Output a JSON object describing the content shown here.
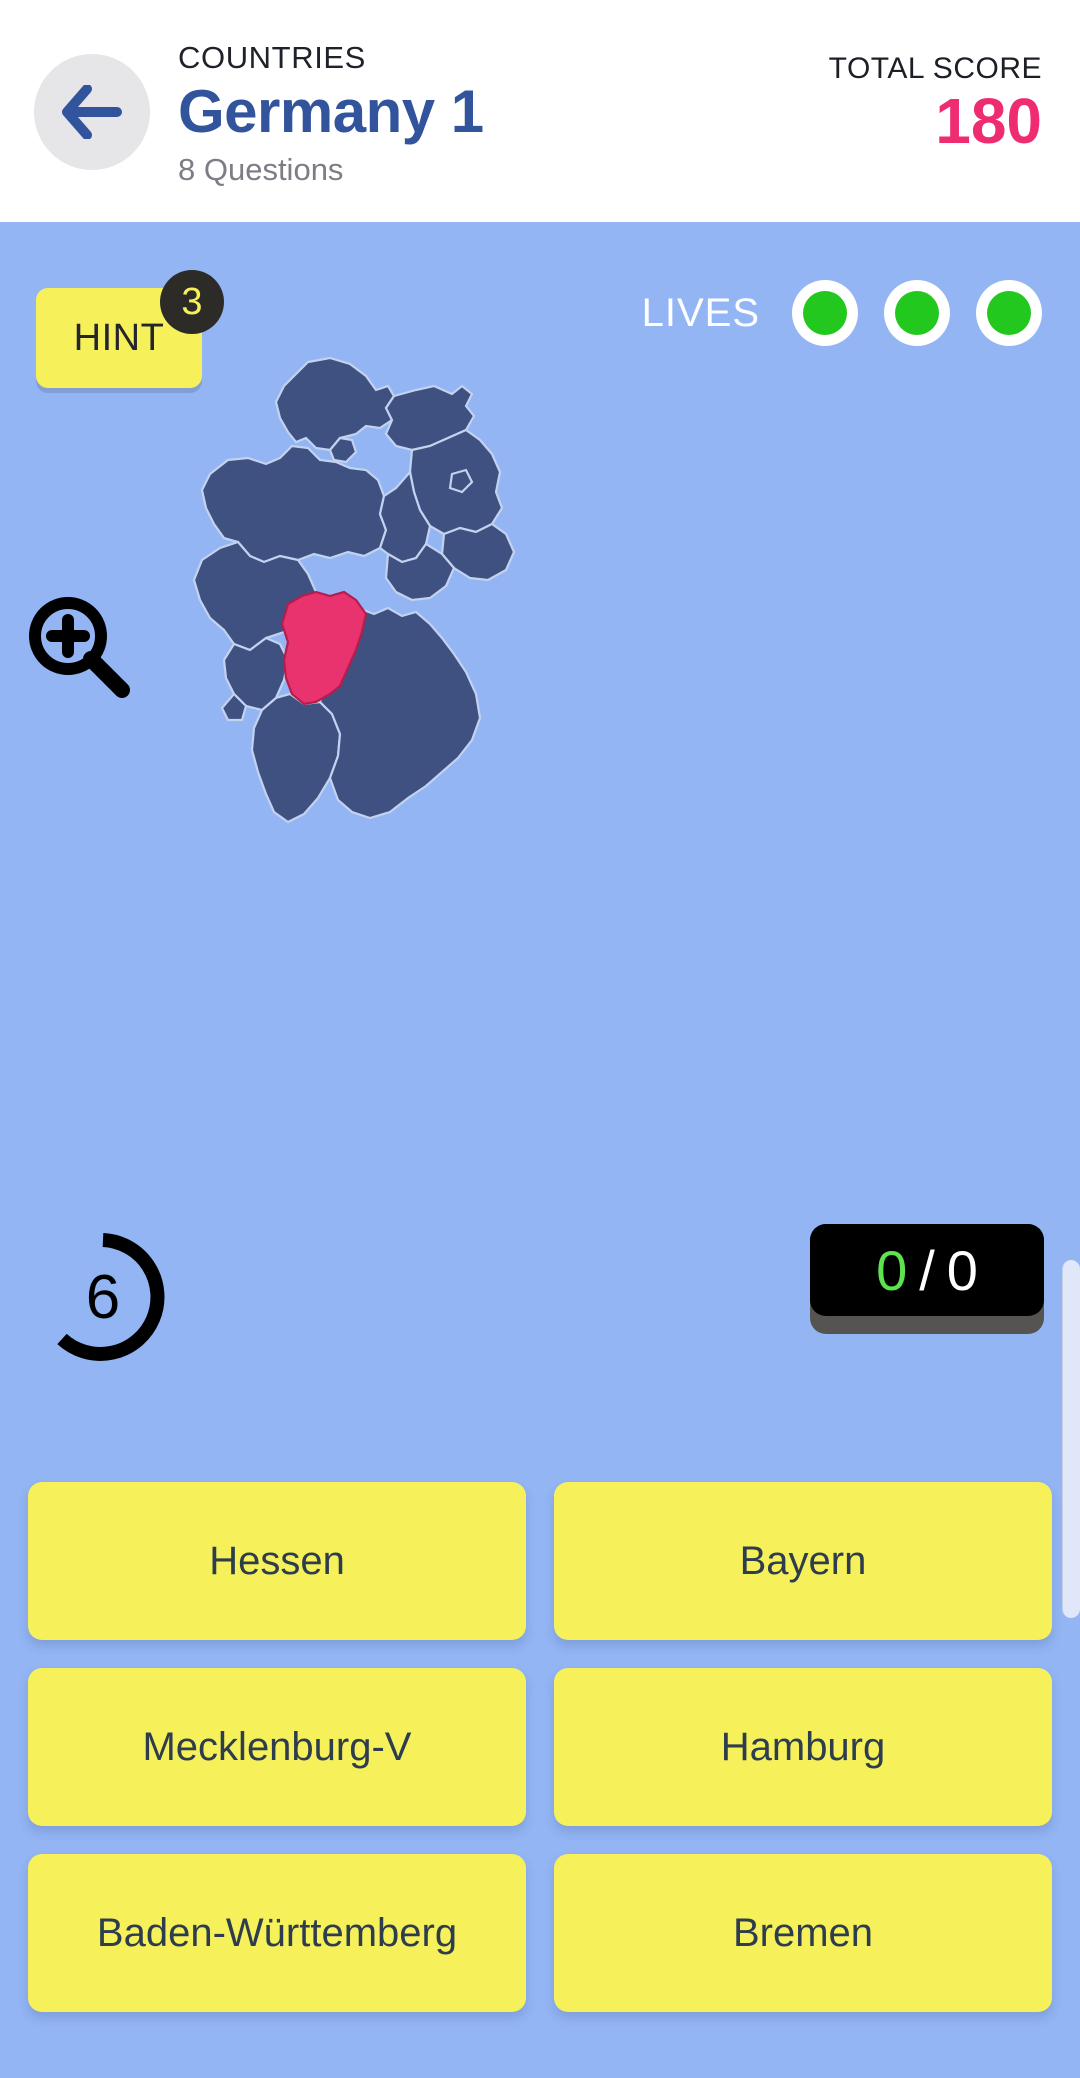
{
  "header": {
    "back_icon": "back-arrow-icon",
    "kicker": "COUNTRIES",
    "title": "Germany 1",
    "subtitle": "8 Questions",
    "score_label": "TOTAL SCORE",
    "score_value": "180",
    "score_color": "#ef2b72",
    "title_color": "#31549c"
  },
  "game": {
    "background_color": "#93b5f4",
    "hint": {
      "label": "HINT",
      "count": "3",
      "button_color": "#f6f15a",
      "badge_color": "#2c2b28"
    },
    "lives": {
      "label": "LIVES",
      "count": 3,
      "dot_color": "#23c81f",
      "ring_color": "#ffffff"
    },
    "zoom_icon": "zoom-in-magnifier-icon",
    "timer": {
      "seconds": "6",
      "arc_color": "#000000",
      "progress_fraction": 0.72
    },
    "scorebox": {
      "current": "0",
      "separator": "/",
      "total": "0",
      "current_color": "#5de34f",
      "background": "#000000"
    },
    "map": {
      "name": "germany-states-map",
      "land_color": "#3e5180",
      "border_color": "#c3d2ee",
      "highlight_color": "#e8336e",
      "highlighted_state": "Hessen"
    }
  },
  "answers": [
    {
      "label": "Hessen"
    },
    {
      "label": "Bayern"
    },
    {
      "label": "Mecklenburg-V"
    },
    {
      "label": "Hamburg"
    },
    {
      "label": "Baden-Württemberg"
    },
    {
      "label": "Bremen"
    }
  ]
}
